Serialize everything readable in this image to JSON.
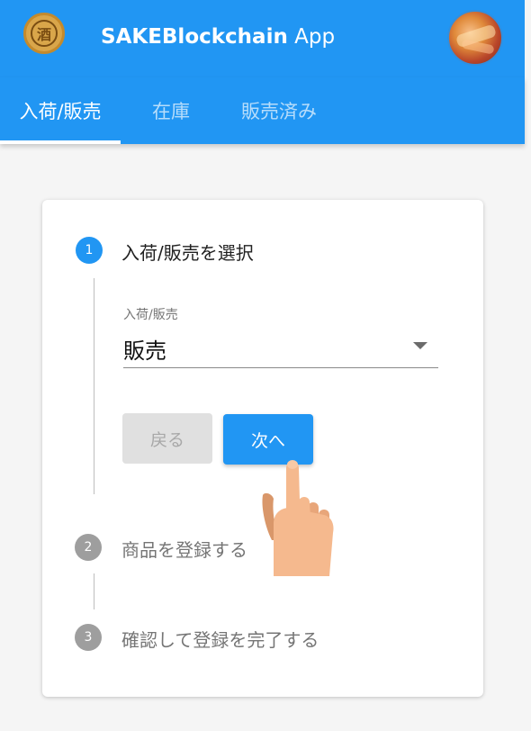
{
  "app": {
    "title_bold": "SAKEBlockchain",
    "title_rest": " App",
    "logo_glyph": "酒"
  },
  "tabs": [
    {
      "label": "入荷/販売",
      "active": true
    },
    {
      "label": "在庫",
      "active": false
    },
    {
      "label": "販売済み",
      "active": false
    }
  ],
  "stepper": {
    "steps": [
      {
        "number": "1",
        "label": "入荷/販売を選択",
        "state": "active"
      },
      {
        "number": "2",
        "label": "商品を登録する",
        "state": "inactive"
      },
      {
        "number": "3",
        "label": "確認して登録を完了する",
        "state": "inactive"
      }
    ],
    "field": {
      "label": "入荷/販売",
      "value": "販売"
    },
    "buttons": {
      "back": "戻る",
      "next": "次へ"
    }
  },
  "colors": {
    "primary": "#2196f3",
    "inactive_step": "#9e9e9e",
    "background": "#f5f5f5"
  },
  "icons": {
    "select_caret": "caret-down-icon",
    "pointer": "pointing-hand-icon"
  }
}
